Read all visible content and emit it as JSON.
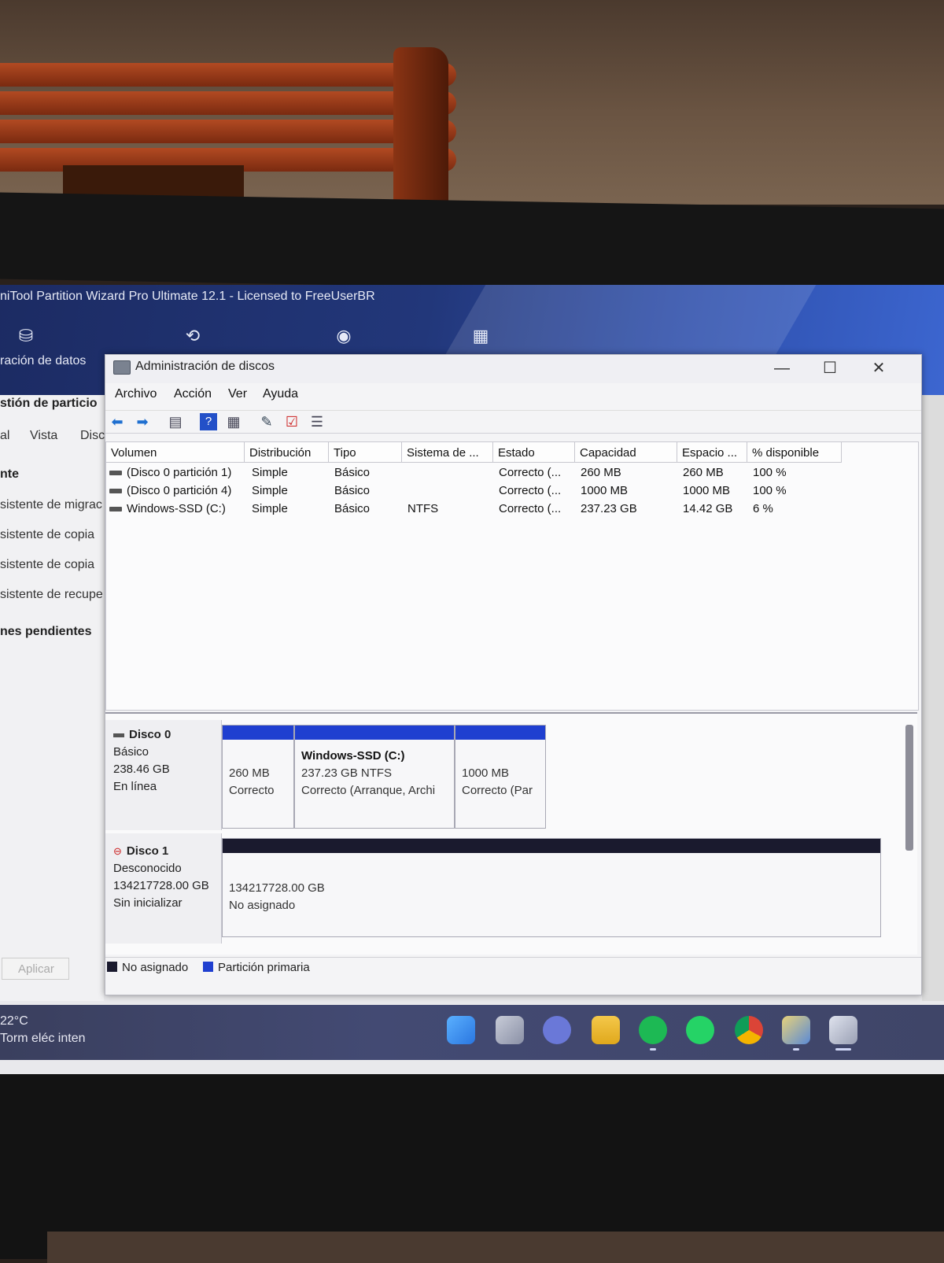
{
  "background_app": {
    "title": "niTool Partition Wizard Pro Ultimate 12.1 - Licensed to FreeUserBR",
    "toolbar_label": "ración de datos",
    "sidebar": {
      "section_title": "stión de particio",
      "tabs": [
        "al",
        "Vista",
        "Disc"
      ],
      "group_title": "nte",
      "items": [
        "sistente de migrac",
        "sistente de copia",
        "sistente de copia",
        "sistente de recupe"
      ],
      "pending_title": "nes pendientes",
      "apply_label": "Aplicar"
    }
  },
  "dialog": {
    "title": "Administración de discos",
    "menu": [
      "Archivo",
      "Acción",
      "Ver",
      "Ayuda"
    ],
    "window_controls": {
      "minimize": "—",
      "maximize": "☐",
      "close": "✕"
    },
    "columns": [
      "Volumen",
      "Distribución",
      "Tipo",
      "Sistema de ...",
      "Estado",
      "Capacidad",
      "Espacio ...",
      "% disponible"
    ],
    "volumes": [
      {
        "volume": "(Disco 0 partición 1)",
        "layout": "Simple",
        "type": "Básico",
        "fs": "",
        "status": "Correcto (...",
        "capacity": "260 MB",
        "free": "260 MB",
        "pct": "100 %"
      },
      {
        "volume": "(Disco 0 partición 4)",
        "layout": "Simple",
        "type": "Básico",
        "fs": "",
        "status": "Correcto (...",
        "capacity": "1000 MB",
        "free": "1000 MB",
        "pct": "100 %"
      },
      {
        "volume": "Windows-SSD (C:)",
        "layout": "Simple",
        "type": "Básico",
        "fs": "NTFS",
        "status": "Correcto (...",
        "capacity": "237.23 GB",
        "free": "14.42 GB",
        "pct": "6 %"
      }
    ],
    "disks": [
      {
        "name": "Disco 0",
        "type": "Básico",
        "size": "238.46 GB",
        "state": "En línea",
        "partitions": [
          {
            "title": "",
            "size": "260 MB",
            "status": "Correcto"
          },
          {
            "title": "Windows-SSD  (C:)",
            "size": "237.23 GB NTFS",
            "status": "Correcto (Arranque, Archi"
          },
          {
            "title": "",
            "size": "1000 MB",
            "status": "Correcto (Par"
          }
        ]
      },
      {
        "name": "Disco 1",
        "type": "Desconocido",
        "size": "134217728.00 GB",
        "state": "Sin inicializar",
        "partitions": [
          {
            "size": "134217728.00 GB",
            "status": "No asignado"
          }
        ]
      }
    ],
    "legend": [
      "No asignado",
      "Partición primaria"
    ]
  },
  "taskbar": {
    "temperature": "22°C",
    "weather_text": "Torm eléc inten",
    "apps": [
      "start-icon",
      "task-view-icon",
      "chat-icon",
      "file-explorer-icon",
      "spotify-icon",
      "whatsapp-icon",
      "chrome-icon",
      "app-icon",
      "disk-management-icon"
    ]
  },
  "colors": {
    "primary_partition": "#1f3fd0",
    "unallocated": "#1a1a2e",
    "taskbar": "#3f4568"
  }
}
